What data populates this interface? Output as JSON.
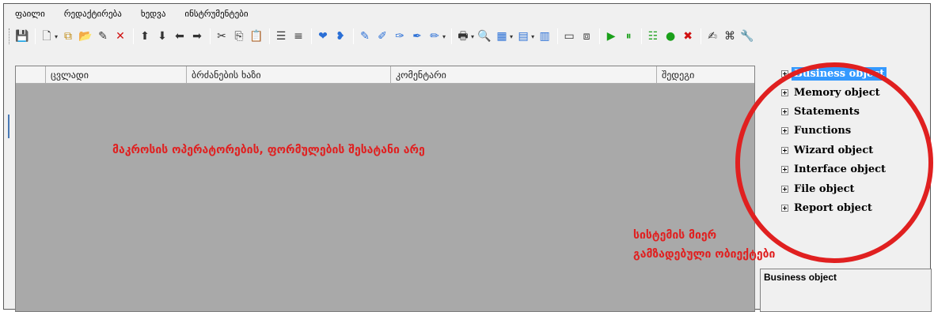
{
  "menu": {
    "items": [
      "ფაილი",
      "რედაქტირება",
      "ხედვა",
      "ინსტრუმენტები"
    ]
  },
  "toolbar": {
    "buttons": [
      {
        "icon": "save-icon",
        "glyph": "💾"
      },
      {
        "icon": "new-document-icon",
        "glyph": "🗋"
      },
      {
        "icon": "copy-objects-icon",
        "glyph": "⧉"
      },
      {
        "icon": "open-folder-icon",
        "glyph": "📂"
      },
      {
        "icon": "edit-icon",
        "glyph": "✎"
      },
      {
        "icon": "delete-icon",
        "glyph": "✕"
      },
      {
        "icon": "arrow-up-icon",
        "glyph": "⬆"
      },
      {
        "icon": "arrow-down-icon",
        "glyph": "⬇"
      },
      {
        "icon": "arrow-left-icon",
        "glyph": "⬅"
      },
      {
        "icon": "arrow-right-icon",
        "glyph": "➡"
      },
      {
        "icon": "cut-icon",
        "glyph": "✂"
      },
      {
        "icon": "copy-icon",
        "glyph": "⎘"
      },
      {
        "icon": "paste-icon",
        "glyph": "📋"
      },
      {
        "icon": "indent-icon",
        "glyph": "☰"
      },
      {
        "icon": "outdent-icon",
        "glyph": "≡"
      },
      {
        "icon": "heart-icon",
        "glyph": "❤"
      },
      {
        "icon": "heart-plus-icon",
        "glyph": "❥"
      },
      {
        "icon": "pen-icon",
        "glyph": "✎"
      },
      {
        "icon": "pen-2-icon",
        "glyph": "✐"
      },
      {
        "icon": "pen-3-icon",
        "glyph": "✑"
      },
      {
        "icon": "pen-4-icon",
        "glyph": "✒"
      },
      {
        "icon": "pen-5-icon",
        "glyph": "✏"
      },
      {
        "icon": "print-icon",
        "glyph": "🖶"
      },
      {
        "icon": "find-icon",
        "glyph": "🔍"
      },
      {
        "icon": "chart-icon",
        "glyph": "▦"
      },
      {
        "icon": "grid-icon",
        "glyph": "▤"
      },
      {
        "icon": "grid-2-icon",
        "glyph": "▥"
      },
      {
        "icon": "window-icon",
        "glyph": "▭"
      },
      {
        "icon": "flow-icon",
        "glyph": "⧈"
      },
      {
        "icon": "play-icon",
        "glyph": "▶"
      },
      {
        "icon": "pause-icon",
        "glyph": "⏸"
      },
      {
        "icon": "list-icon",
        "glyph": "☷"
      },
      {
        "icon": "green-circle-icon",
        "glyph": "●"
      },
      {
        "icon": "red-x-icon",
        "glyph": "✖"
      },
      {
        "icon": "pencil-edit-icon",
        "glyph": "✍"
      },
      {
        "icon": "xml-icon",
        "glyph": "⌘"
      },
      {
        "icon": "wrench-icon",
        "glyph": "🔧"
      }
    ]
  },
  "grid": {
    "columns": [
      "ცვლადი",
      "ბრძანების ხაზი",
      "კომენტარი",
      "შედეგი"
    ]
  },
  "annotations": {
    "macro_text": "მაკროსის ოპერატორების, ფორმულების შესატანი არე",
    "system_line1": "სისტემის მიერ",
    "system_line2": "გამზადებული ობიექტები"
  },
  "tree": {
    "items": [
      {
        "label": "Business object",
        "selected": true
      },
      {
        "label": "Memory object",
        "selected": false
      },
      {
        "label": "Statements",
        "selected": false
      },
      {
        "label": "Functions",
        "selected": false
      },
      {
        "label": "Wizard object",
        "selected": false
      },
      {
        "label": "Interface object",
        "selected": false
      },
      {
        "label": "File object",
        "selected": false
      },
      {
        "label": "Report object",
        "selected": false
      }
    ]
  },
  "description": {
    "text": "Business object"
  },
  "colors": {
    "annotation_red": "#e02020",
    "selection_blue": "#3399ff",
    "grid_gray": "#a9a9a9"
  }
}
